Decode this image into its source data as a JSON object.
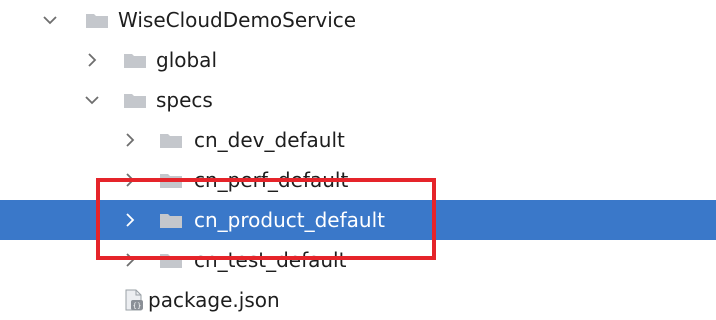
{
  "tree": {
    "root": {
      "label": "WiseCloudDemoService",
      "icon": "folder-icon",
      "expanded": true
    },
    "global": {
      "label": "global",
      "icon": "folder-icon",
      "expanded": false
    },
    "specs": {
      "label": "specs",
      "icon": "folder-icon",
      "expanded": true
    },
    "specs_children": [
      {
        "label": "cn_dev_default",
        "icon": "folder-icon",
        "expanded": false
      },
      {
        "label": "cn_perf_default",
        "icon": "folder-icon",
        "expanded": false
      },
      {
        "label": "cn_product_default",
        "icon": "folder-icon",
        "expanded": false,
        "selected": true
      },
      {
        "label": "cn_test_default",
        "icon": "folder-icon",
        "expanded": false
      }
    ],
    "package": {
      "label": "package.json",
      "icon": "json-file-icon"
    }
  },
  "colors": {
    "selection": "#3a78c9",
    "highlight_border": "#e5242a",
    "folder": "#c4c7cc",
    "chevron": "#6e6e6e"
  }
}
